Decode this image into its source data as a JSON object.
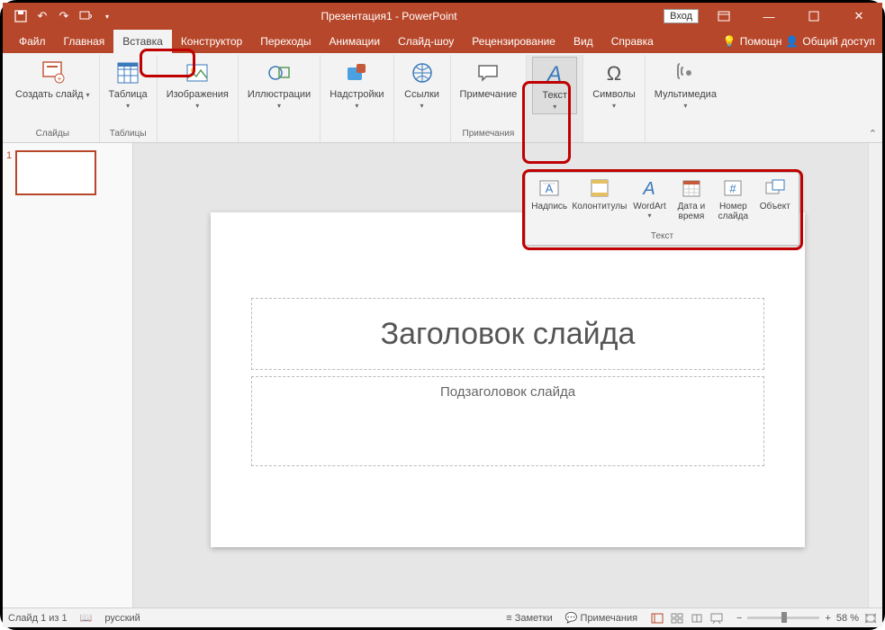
{
  "qat": {
    "tooltip_save": "save",
    "tooltip_undo": "undo",
    "tooltip_redo": "redo"
  },
  "title": "Презентация1 - PowerPoint",
  "signin": "Вход",
  "tabs": {
    "file": "Файл",
    "home": "Главная",
    "insert": "Вставка",
    "design": "Конструктор",
    "transitions": "Переходы",
    "animations": "Анимации",
    "slideshow": "Слайд-шоу",
    "review": "Рецензирование",
    "view": "Вид",
    "help": "Справка",
    "tellme": "Помощн",
    "share": "Общий доступ"
  },
  "ribbon": {
    "new_slide": "Создать слайд",
    "slides_group": "Слайды",
    "table": "Таблица",
    "tables_group": "Таблицы",
    "images": "Изображения",
    "illustrations": "Иллюстрации",
    "addins": "Надстройки",
    "links": "Ссылки",
    "comment": "Примечание",
    "comments_group": "Примечания",
    "text": "Текст",
    "symbols": "Символы",
    "media": "Мультимедиа"
  },
  "flyout": {
    "textbox": "Надпись",
    "header_footer": "Колонтитулы",
    "wordart": "WordArt",
    "date_time": "Дата и время",
    "slide_number": "Номер слайда",
    "object": "Объект",
    "group_label": "Текст"
  },
  "slide": {
    "number": "1",
    "title_placeholder": "Заголовок слайда",
    "subtitle_placeholder": "Подзаголовок слайда"
  },
  "status": {
    "slide_count": "Слайд 1 из 1",
    "language": "русский",
    "notes": "Заметки",
    "comments": "Примечания",
    "zoom": "58 %"
  }
}
